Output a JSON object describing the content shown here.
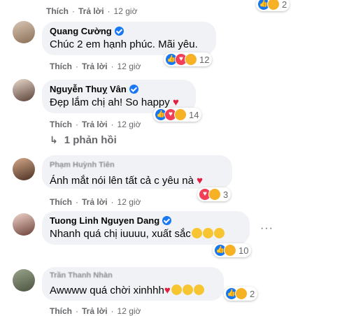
{
  "top_row": {
    "like": "Thích",
    "reply": "Trả lời",
    "time": "12 giờ",
    "reactions": "2"
  },
  "comments": [
    {
      "name": "Quang Cường",
      "text": "Chúc 2 em hạnh phúc. Mãi yêu.",
      "like": "Thích",
      "reply": "Trả lời",
      "time": "12 giờ",
      "reactions": "12",
      "reaction_icons": [
        "like-icon",
        "love-icon",
        "care-icon"
      ]
    },
    {
      "name": "Nguyễn Thuỵ Vân",
      "text": "Đẹp lắm chị ah! So happy",
      "like": "Thích",
      "reply": "Trả lời",
      "time": "12 giờ",
      "reactions": "14",
      "reaction_icons": [
        "like-icon",
        "love-icon",
        "care-icon"
      ]
    },
    {
      "name": "Phạm Huỳnh Tiên",
      "text": "Ánh mắt nói lên tất cả c yêu nà",
      "like": "Thích",
      "reply": "Trả lời",
      "time": "12 giờ",
      "reactions": "3",
      "reaction_icons": [
        "love-icon",
        "care-icon"
      ]
    },
    {
      "name": "Tuong Linh Nguyen Dang",
      "text": "Nhanh quá chị iuuuu, xuất sắc",
      "like": "Thích",
      "reply": "Trả lời",
      "time": "12 giờ",
      "reactions": "10",
      "reaction_icons": [
        "like-icon",
        "care-icon"
      ]
    },
    {
      "name": "Trần Thanh Nhàn",
      "text": "Awwww quá chời xinhhh",
      "like": "Thích",
      "reply": "Trả lời",
      "time": "12 giờ",
      "reactions": "2",
      "reaction_icons": [
        "like-icon",
        "care-icon"
      ]
    }
  ],
  "replies_link": "1 phản hồi",
  "more_options": "···",
  "colors": {
    "bubble": "#f0f2f5",
    "meta": "#65676b",
    "like": "#1877f2",
    "love": "#f33e58",
    "care": "#f7b125"
  }
}
